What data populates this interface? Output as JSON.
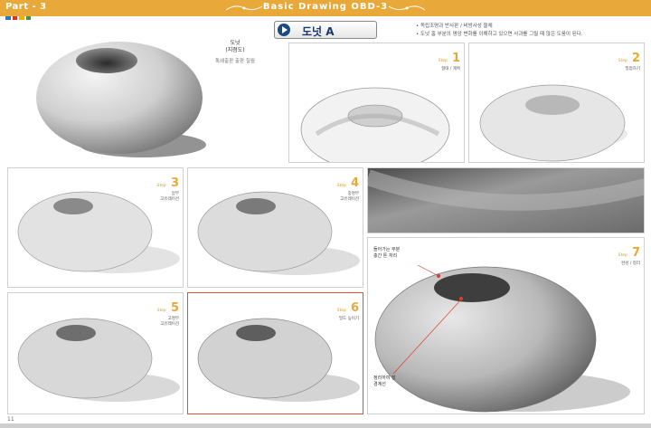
{
  "header": {
    "part_label": "Part - 3",
    "title": "Basic Drawing OBD-3",
    "colors": {
      "bar": "#e8a93a",
      "stripes": [
        "#2a7ab8",
        "#d6332a",
        "#f0b400",
        "#3a9a3a"
      ]
    }
  },
  "title_button": {
    "label": "도넛 A",
    "icon": "play-icon"
  },
  "notes": [
    "• 독립조명과 반사판 / 비방사성 을체",
    "• 도넛 홈 부분의 명암 변화를 이해하고 있으면 사과를 그릴 때 많은 도움이 된다."
  ],
  "main_caption": {
    "line1": "도넛",
    "line2": "(지점도)",
    "line3": "톡쇄출판 출판 칠월"
  },
  "steps": [
    {
      "label": "Step",
      "num": "1",
      "desc": "형태 / 계획"
    },
    {
      "label": "Step",
      "num": "2",
      "desc": "밀접하기"
    },
    {
      "label": "Step",
      "num": "3",
      "desc": "암부\n고유레이션"
    },
    {
      "label": "Step",
      "num": "4",
      "desc": "중명부\n고유레이션"
    },
    {
      "label": "Step",
      "num": "5",
      "desc": "고명부\n고유레이션"
    },
    {
      "label": "Step",
      "num": "6",
      "desc": "밀도 높이기"
    },
    {
      "label": "Step",
      "num": "7",
      "desc": "완성 / 정리"
    }
  ],
  "annotations": {
    "top": "들어가는 부분\n충간 톤 처리",
    "bottom": "정리하여 잘\n경계선"
  },
  "page_number": "11"
}
